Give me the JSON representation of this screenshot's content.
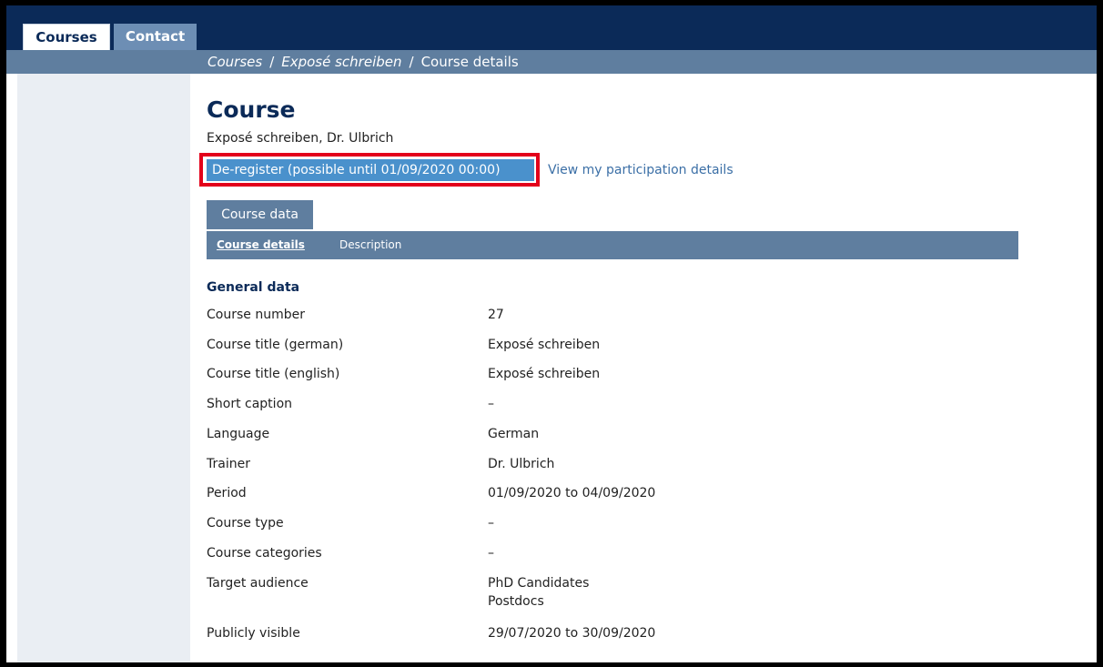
{
  "nav": {
    "tabs": [
      {
        "label": "Courses"
      },
      {
        "label": "Contact"
      }
    ]
  },
  "breadcrumb": {
    "items": [
      "Courses",
      "Exposé schreiben",
      "Course details"
    ],
    "separator": "/"
  },
  "page": {
    "title": "Course",
    "subtitle": "Exposé schreiben, Dr. Ulbrich",
    "deregister_label": "De-register (possible until 01/09/2020 00:00)",
    "participation_link": "View my participation details"
  },
  "section_tab": {
    "label": "Course data"
  },
  "subtabs": [
    {
      "label": "Course details",
      "active": true
    },
    {
      "label": "Description",
      "active": false
    }
  ],
  "general_data": {
    "heading": "General data",
    "rows": [
      {
        "label": "Course number",
        "value": "27"
      },
      {
        "label": "Course title (german)",
        "value": "Exposé schreiben"
      },
      {
        "label": "Course title (english)",
        "value": "Exposé schreiben"
      },
      {
        "label": "Short caption",
        "value": "–"
      },
      {
        "label": "Language",
        "value": "German"
      },
      {
        "label": "Trainer",
        "value": "Dr. Ulbrich"
      },
      {
        "label": "Period",
        "value": "01/09/2020 to 04/09/2020"
      },
      {
        "label": "Course type",
        "value": "–"
      },
      {
        "label": "Course categories",
        "value": "–"
      },
      {
        "label": "Target audience",
        "value": "PhD Candidates",
        "value2": "Postdocs"
      },
      {
        "label": "Publicly visible",
        "value": "29/07/2020 to 30/09/2020"
      }
    ]
  },
  "colors": {
    "navy": "#0b2a58",
    "bar": "#5f7e9f",
    "contact_tab": "#6d8eb4",
    "button": "#4a91cc",
    "highlight": "#e3001b",
    "link": "#3b6fa6",
    "sidebar": "#eaeef3"
  }
}
